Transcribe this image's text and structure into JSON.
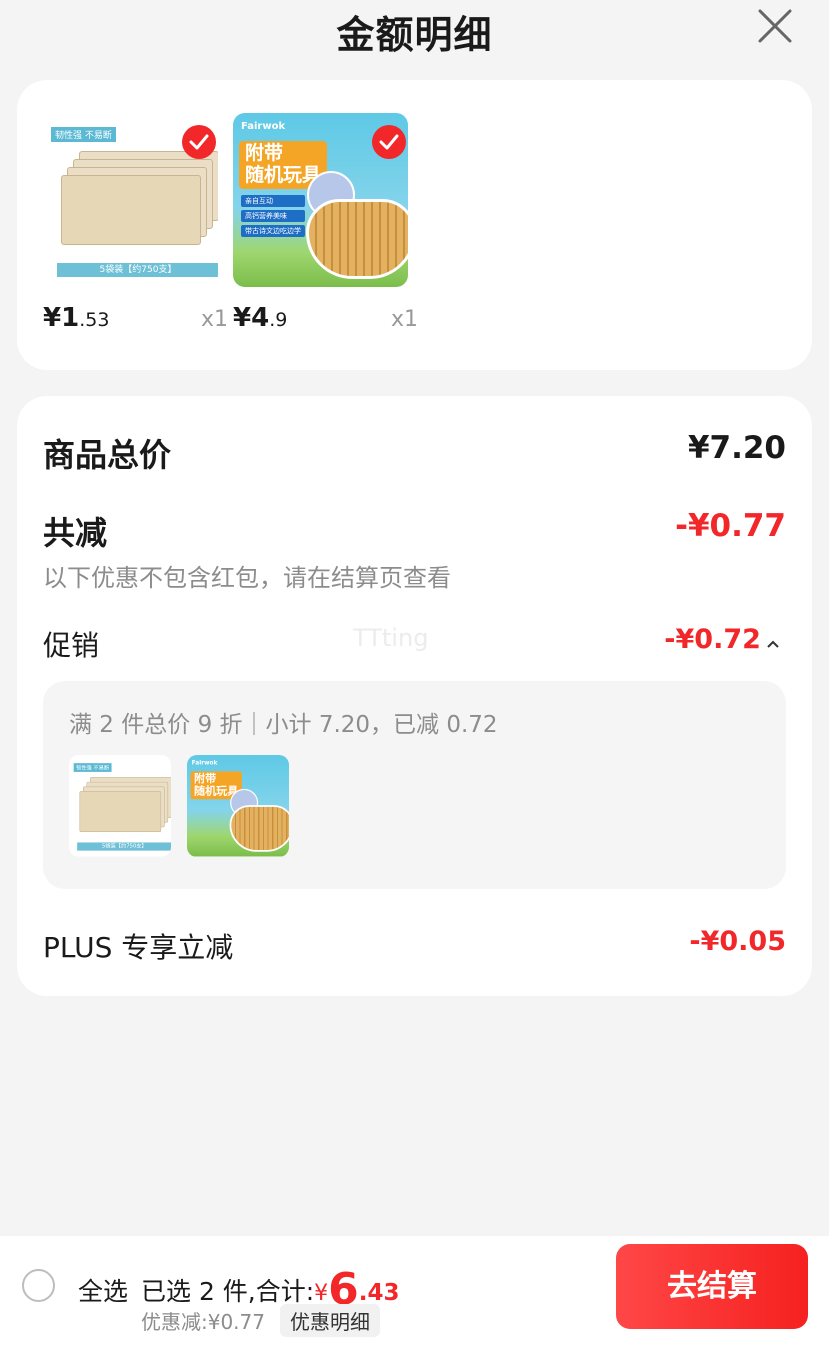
{
  "header": {
    "title": "金额明细"
  },
  "products": [
    {
      "badge": "韧性强 不易断",
      "band": "5袋装【约750支】",
      "price_int": "1",
      "price_dec": ".53",
      "qty": "x1",
      "selected": true
    },
    {
      "badge": "Fairwok",
      "band": "附带\n随机玩具",
      "price_int": "4",
      "price_dec": ".9",
      "qty": "x1",
      "selected": true
    }
  ],
  "summary": {
    "total_label": "商品总价",
    "total_value": "¥7.20",
    "discount_label": "共减",
    "discount_value": "-¥0.77",
    "discount_note": "以下优惠不包含红包，请在结算页查看",
    "promo_label": "促销",
    "promo_value": "-¥0.72",
    "promo_caret": "^",
    "promo_desc": "满 2 件总价 9 折｜小计 7.20，已减 0.72",
    "plus_label": "PLUS 专享立减",
    "plus_value": "-¥0.05",
    "watermark": "TTting"
  },
  "bottom": {
    "select_all": "全选",
    "selected_text": "已选 2 件,合计:",
    "currency": "¥",
    "amount_int": "6",
    "amount_dec": ".43",
    "saving": "优惠减:¥0.77",
    "detail_link": "优惠明细",
    "checkout": "去结算"
  },
  "colors": {
    "accent": "#f2272a",
    "muted": "#8c8c8c"
  },
  "icons": [
    "close-icon",
    "check-icon",
    "radio-icon",
    "caret-up-icon"
  ]
}
